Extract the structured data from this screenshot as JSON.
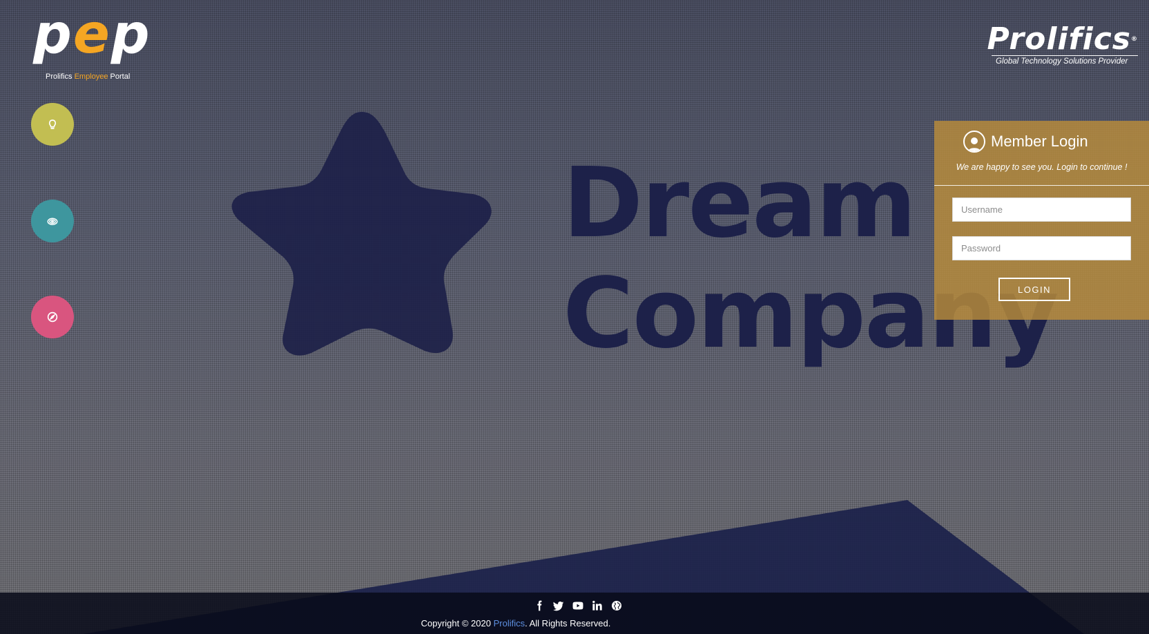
{
  "branding": {
    "pep_logo_prefix": "p",
    "pep_logo_mid": "e",
    "pep_logo_suffix": "p",
    "tagline_prefix": "Prolifics ",
    "tagline_highlight": "Employee",
    "tagline_suffix": " Portal",
    "company_name": "Prolifics",
    "company_reg": "®",
    "company_tagline": "Global Technology Solutions Provider",
    "accent_color": "#f5a623"
  },
  "side_buttons": [
    {
      "icon": "lightbulb-icon",
      "color": "#c2be52"
    },
    {
      "icon": "spiral-icon",
      "color": "#3e969e"
    },
    {
      "icon": "compass-icon",
      "color": "#d9557f"
    }
  ],
  "hero": {
    "line1": "Dream",
    "line2": "Company",
    "color": "#1d2149"
  },
  "login": {
    "title": "Member Login",
    "subtitle": "We are happy to see you. Login to continue !",
    "username_placeholder": "Username",
    "password_placeholder": "Password",
    "button_label": "LOGIN",
    "panel_color": "#ba8c3a"
  },
  "footer": {
    "social_icons": [
      "facebook-icon",
      "twitter-icon",
      "youtube-icon",
      "linkedin-icon",
      "globe-icon"
    ],
    "copyright_prefix": "Copyright © 2020 ",
    "copyright_link": "Prolifics",
    "copyright_suffix": ". All Rights Reserved."
  }
}
